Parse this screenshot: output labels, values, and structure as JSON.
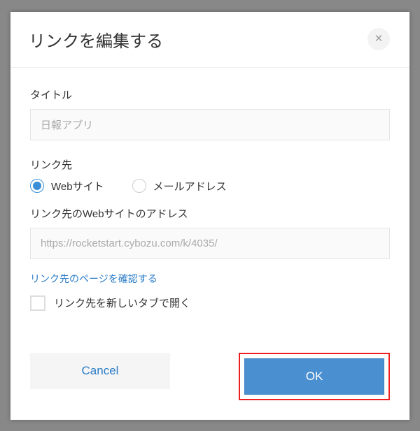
{
  "dialog": {
    "title": "リンクを編集する",
    "close_icon": "×"
  },
  "fields": {
    "title_label": "タイトル",
    "title_value": "日報アプリ",
    "dest_label": "リンク先",
    "radio_website": "Webサイト",
    "radio_email": "メールアドレス",
    "url_label": "リンク先のWebサイトのアドレス",
    "url_value": "https://rocketstart.cybozu.com/k/4035/",
    "check_link": "リンク先のページを確認する",
    "newtab_label": "リンク先を新しいタブで開く"
  },
  "footer": {
    "cancel": "Cancel",
    "ok": "OK"
  }
}
